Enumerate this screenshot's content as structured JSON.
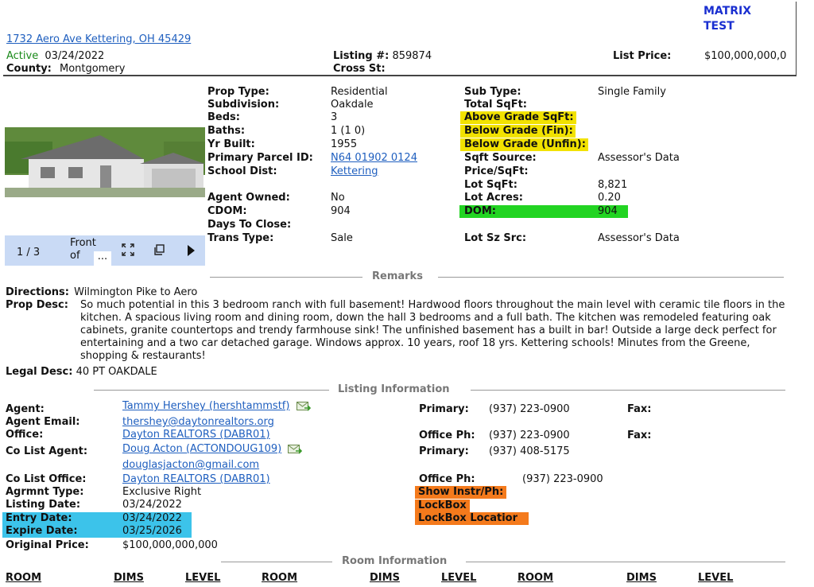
{
  "header": {
    "brand": "MATRIX\nTEST",
    "address": "1732 Aero Ave Kettering, OH 45429",
    "status": "Active",
    "status_date": "03/24/2022",
    "county_label": "County:",
    "county_value": "Montgomery",
    "listing_label": "Listing #:",
    "listing_value": "859874",
    "cross_label": "Cross St:",
    "price_label": "List Price:",
    "price_value": "$100,000,000,0"
  },
  "photo": {
    "counter": "1 / 3",
    "caption_line1": "Front",
    "caption_line2": "of",
    "caption_more": "..."
  },
  "props_left": [
    {
      "label": "Prop Type:",
      "value": "Residential"
    },
    {
      "label": "Subdivision:",
      "value": "Oakdale"
    },
    {
      "label": "Beds:",
      "value": "3"
    },
    {
      "label": "Baths:",
      "value": "1 (1 0)"
    },
    {
      "label": "Yr Built:",
      "value": "1955"
    },
    {
      "label": "Primary Parcel ID:",
      "value": "N64 01902 0124"
    },
    {
      "label": "School Dist:",
      "value": "Kettering"
    },
    {
      "label": "Agent Owned:",
      "value": "No"
    },
    {
      "label": "CDOM:",
      "value": "904"
    },
    {
      "label": "Days To Close:",
      "value": ""
    },
    {
      "label": "Trans Type:",
      "value": "Sale"
    }
  ],
  "props_right": [
    {
      "label": "Sub Type:",
      "value": "Single Family"
    },
    {
      "label": "Total SqFt:",
      "value": ""
    },
    {
      "label": "Above Grade SqFt:",
      "value": ""
    },
    {
      "label": "Below Grade (Fin):",
      "value": ""
    },
    {
      "label": "Below Grade (Unfin):",
      "value": ""
    },
    {
      "label": "Sqft Source:",
      "value": "Assessor's Data"
    },
    {
      "label": "Price/SqFt:",
      "value": ""
    },
    {
      "label": "Lot SqFt:",
      "value": "8,821"
    },
    {
      "label": "Lot Acres:",
      "value": "0.20"
    },
    {
      "label": "DOM:",
      "value": "904"
    },
    {
      "label": "Lot Sz Src:",
      "value": "Assessor's Data"
    }
  ],
  "remarks": {
    "title": "Remarks",
    "directions_label": "Directions:",
    "directions_value": "Wilmington Pike to Aero",
    "desc_label": "Prop Desc:",
    "desc_value": "So much potential in this 3 bedroom ranch with full basement! Hardwood floors throughout the main level with ceramic tile floors in the kitchen. A spacious living room and dining room, down the hall 3 bedrooms and a full bath. The kitchen was remodeled featuring oak cabinets, granite countertops and trendy farmhouse sink! The unfinished basement has a built in bar! Outside a large deck perfect for entertaining and a two car detached garage. Windows approx. 10 years, roof 18 yrs. Kettering schools! Minutes from the Greene, shopping & restaurants!",
    "legal_label": "Legal Desc:",
    "legal_value": "40 PT OAKDALE"
  },
  "listing": {
    "title": "Listing Information",
    "agent_label": "Agent:",
    "agent_value": "Tammy Hershey (hershtammstf)",
    "agent_email_label": "Agent Email:",
    "agent_email_value": "thershey@daytonrealtors.org",
    "office_label": "Office:",
    "office_value": "Dayton REALTORS (DABR01)",
    "colist_label": "Co List Agent:",
    "colist_value": "Doug Acton (ACTONDOUG109)",
    "colist_email_value": "douglasjacton@gmail.com",
    "colist_office_label": "Co List Office:",
    "colist_office_value": "Dayton REALTORS (DABR01)",
    "agrmnt_label": "Agrmnt Type:",
    "agrmnt_value": "Exclusive Right",
    "listing_date_label": "Listing Date:",
    "listing_date_value": "03/24/2022",
    "entry_date_label": "Entry Date:",
    "entry_date_value": "03/24/2022",
    "expire_date_label": "Expire Date:",
    "expire_date_value": "03/25/2026",
    "orig_price_label": "Original Price:",
    "orig_price_value": "$100,000,000,000",
    "primary_label": "Primary:",
    "primary_value": "(937) 223-0900",
    "fax_label": "Fax:",
    "office_ph_label": "Office Ph:",
    "office_ph_value": "(937) 223-0900",
    "fax2_label": "Fax:",
    "primary2_label": "Primary:",
    "primary2_value": "(937) 408-5175",
    "office_ph2_label": "Office Ph:",
    "office_ph2_value": "(937) 223-0900",
    "show_label": "Show Instr/Ph:",
    "lockbox_label": "LockBox",
    "lockbox_loc_label": "LockBox Locatior"
  },
  "rooms": {
    "title": "Room Information",
    "headers": [
      "ROOM",
      "DIMS",
      "LEVEL",
      "ROOM",
      "DIMS",
      "LEVEL",
      "ROOM",
      "DIMS",
      "LEVEL"
    ]
  }
}
